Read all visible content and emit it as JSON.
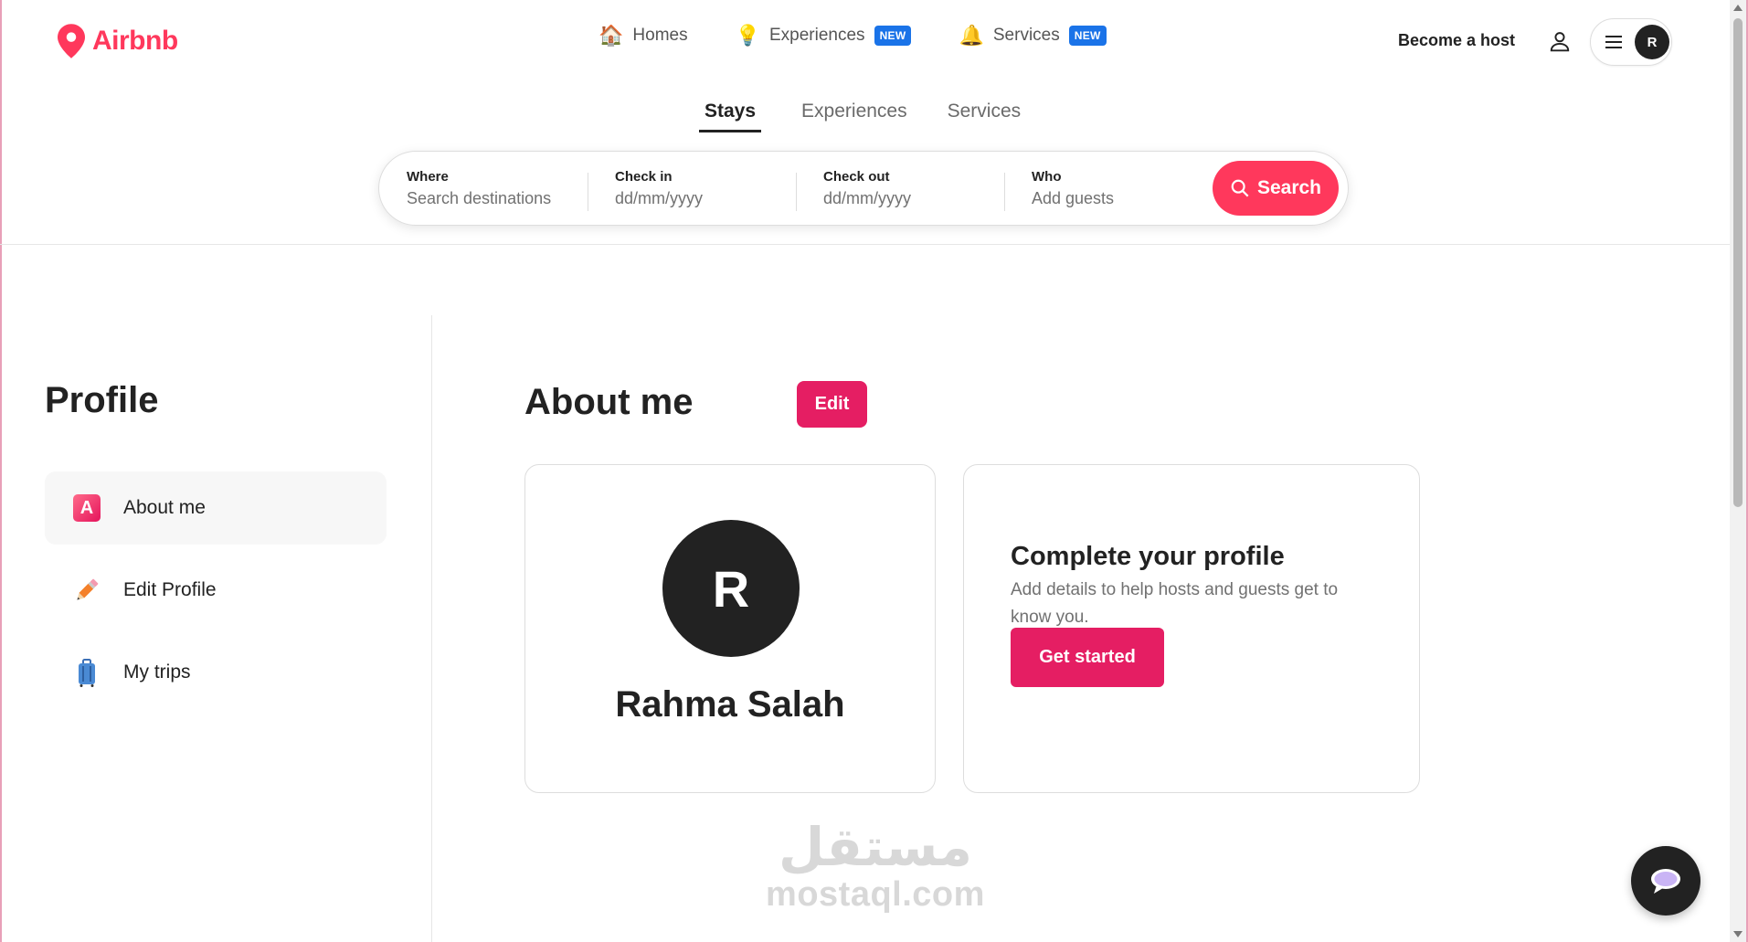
{
  "brand": {
    "name": "Airbnb",
    "color": "#ff385c"
  },
  "topnav": [
    {
      "label": "Homes",
      "icon": "house-icon",
      "emoji": "🏠",
      "badge": ""
    },
    {
      "label": "Experiences",
      "icon": "lightbulb-icon",
      "emoji": "💡",
      "badge": "NEW"
    },
    {
      "label": "Services",
      "icon": "bell-icon",
      "emoji": "🔔",
      "badge": "NEW"
    }
  ],
  "header": {
    "become_host": "Become a host",
    "avatar_initial": "R"
  },
  "tabs": [
    {
      "label": "Stays",
      "active": true
    },
    {
      "label": "Experiences",
      "active": false
    },
    {
      "label": "Services",
      "active": false
    }
  ],
  "search": {
    "where_label": "Where",
    "where_placeholder": "Search destinations",
    "checkin_label": "Check in",
    "checkin_placeholder": "dd/mm/yyyy",
    "checkout_label": "Check out",
    "checkout_placeholder": "dd/mm/yyyy",
    "who_label": "Who",
    "who_placeholder": "Add guests",
    "button_label": "Search"
  },
  "sidebar": {
    "title": "Profile",
    "items": [
      {
        "label": "About me",
        "icon": "letter-a-icon",
        "active": true
      },
      {
        "label": "Edit Profile",
        "icon": "pencil-icon",
        "active": false
      },
      {
        "label": "My trips",
        "icon": "luggage-icon",
        "active": false
      }
    ]
  },
  "main": {
    "title": "About me",
    "edit_label": "Edit",
    "profile": {
      "initial": "R",
      "name": "Rahma Salah"
    },
    "complete": {
      "title": "Complete your profile",
      "description": "Add details to help hosts and guests get to know you.",
      "button_label": "Get started"
    }
  },
  "watermark": {
    "arabic": "مستقل",
    "latin": "mostaql.com"
  },
  "colors": {
    "accent": "#e51e63",
    "brand": "#ff385c",
    "badge": "#1a73e8",
    "dark": "#222222"
  }
}
